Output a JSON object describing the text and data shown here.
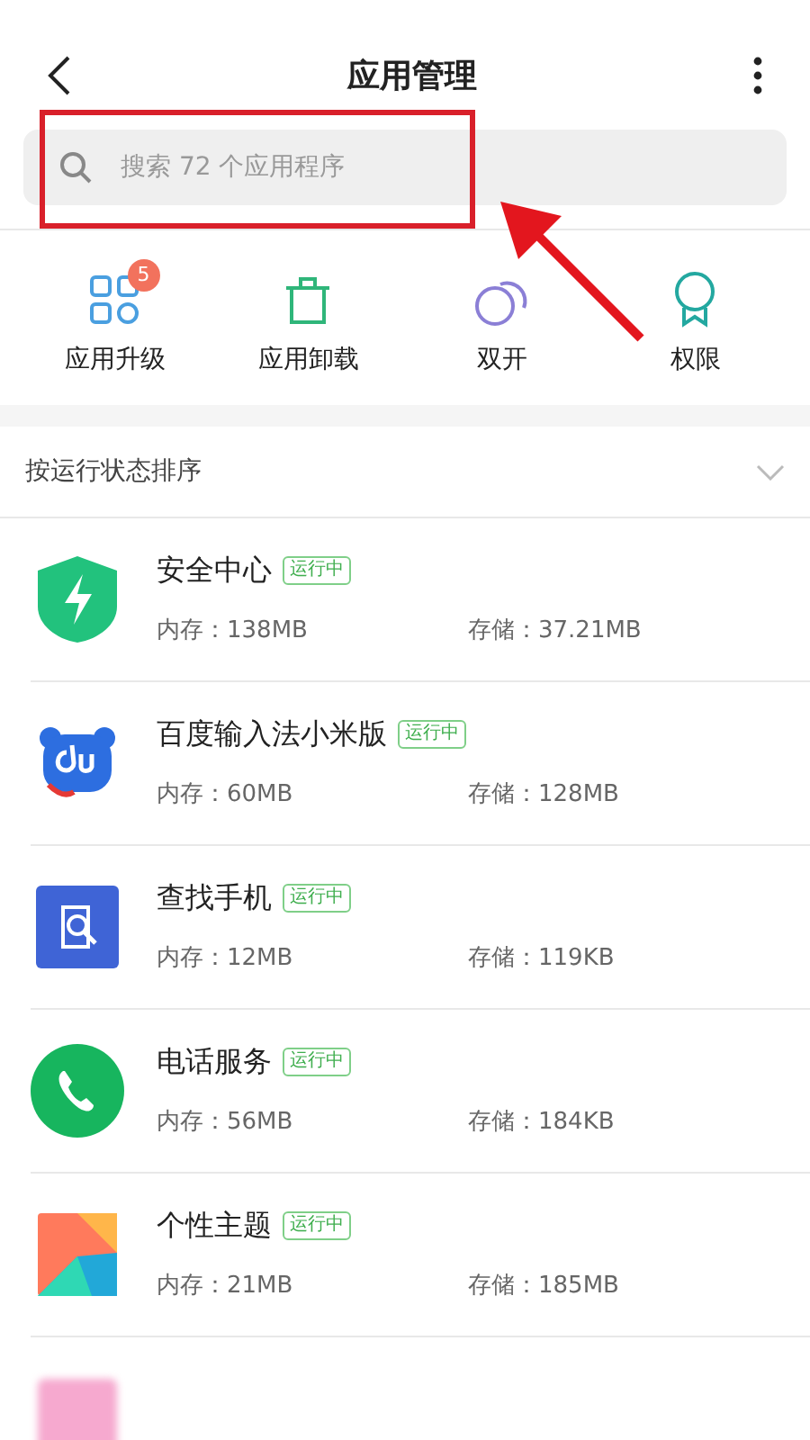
{
  "header": {
    "title": "应用管理"
  },
  "search": {
    "placeholder": "搜索 72 个应用程序"
  },
  "annotation": {
    "highlight": true
  },
  "shortcuts": [
    {
      "kind": "upgrade",
      "label": "应用升级",
      "badge": "5"
    },
    {
      "kind": "uninstall",
      "label": "应用卸载"
    },
    {
      "kind": "dual",
      "label": "双开"
    },
    {
      "kind": "permissions",
      "label": "权限"
    }
  ],
  "sort": {
    "label": "按运行状态排序"
  },
  "apps": [
    {
      "kind": "security",
      "name": "安全中心",
      "status": "运行中",
      "memory": "内存：138MB",
      "storage": "存储：37.21MB"
    },
    {
      "kind": "baidu",
      "name": "百度输入法小米版",
      "status": "运行中",
      "memory": "内存：60MB",
      "storage": "存储：128MB"
    },
    {
      "kind": "findphone",
      "name": "查找手机",
      "status": "运行中",
      "memory": "内存：12MB",
      "storage": "存储：119KB"
    },
    {
      "kind": "phone",
      "name": "电话服务",
      "status": "运行中",
      "memory": "内存：56MB",
      "storage": "存储：184KB"
    },
    {
      "kind": "theme",
      "name": "个性主题",
      "status": "运行中",
      "memory": "内存：21MB",
      "storage": "存储：185MB"
    },
    {
      "kind": "blurred"
    }
  ]
}
